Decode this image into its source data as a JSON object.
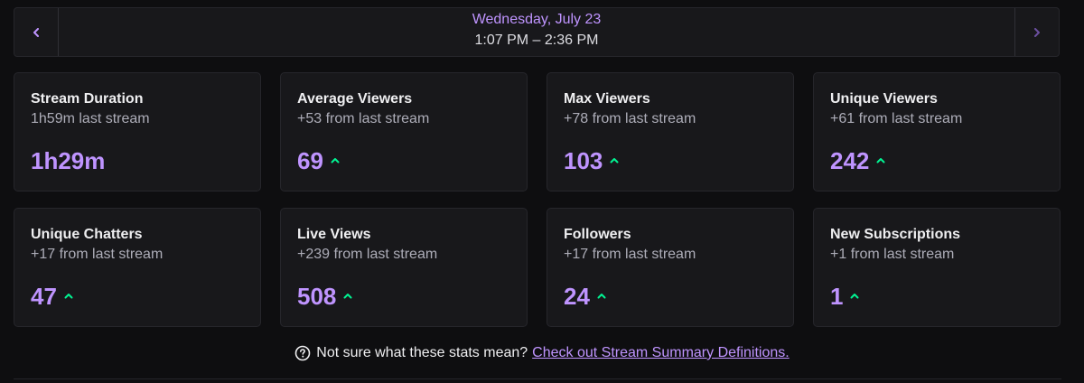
{
  "date_nav": {
    "title": "Wednesday, July 23",
    "range": "1:07 PM – 2:36 PM",
    "prev_icon": "chevron-left-icon",
    "next_icon": "chevron-right-icon"
  },
  "colors": {
    "background": "#0e0e10",
    "card": "#18181b",
    "accent": "#bf94ff",
    "trend_up": "#00f593",
    "subtext": "#adadb8"
  },
  "stats": [
    {
      "name": "stream-duration",
      "title": "Stream Duration",
      "subtitle": "1h59m last stream",
      "value": "1h29m",
      "trend": "none"
    },
    {
      "name": "average-viewers",
      "title": "Average Viewers",
      "subtitle": "+53 from last stream",
      "value": "69",
      "trend": "up"
    },
    {
      "name": "max-viewers",
      "title": "Max Viewers",
      "subtitle": "+78 from last stream",
      "value": "103",
      "trend": "up"
    },
    {
      "name": "unique-viewers",
      "title": "Unique Viewers",
      "subtitle": "+61 from last stream",
      "value": "242",
      "trend": "up"
    },
    {
      "name": "unique-chatters",
      "title": "Unique Chatters",
      "subtitle": "+17 from last stream",
      "value": "47",
      "trend": "up"
    },
    {
      "name": "live-views",
      "title": "Live Views",
      "subtitle": "+239 from last stream",
      "value": "508",
      "trend": "up"
    },
    {
      "name": "followers",
      "title": "Followers",
      "subtitle": "+17 from last stream",
      "value": "24",
      "trend": "up"
    },
    {
      "name": "new-subscriptions",
      "title": "New Subscriptions",
      "subtitle": "+1 from last stream",
      "value": "1",
      "trend": "up"
    }
  ],
  "help": {
    "icon": "question-circle-icon",
    "text": "Not sure what these stats mean?",
    "link_text": "Check out Stream Summary Definitions."
  }
}
